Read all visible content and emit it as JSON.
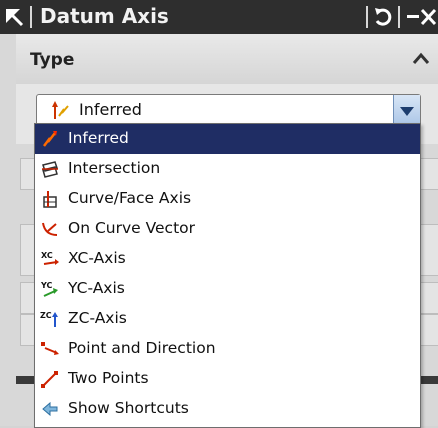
{
  "window": {
    "title": "Datum Axis"
  },
  "type_group": {
    "label": "Type"
  },
  "type_select": {
    "value": "Inferred"
  },
  "dropdown": {
    "options": [
      {
        "label": "Inferred",
        "icon": "inferred-icon",
        "selected": true
      },
      {
        "label": "Intersection",
        "icon": "intersection-icon"
      },
      {
        "label": "Curve/Face Axis",
        "icon": "curve-face-axis-icon"
      },
      {
        "label": "On Curve Vector",
        "icon": "on-curve-vector-icon"
      },
      {
        "label": "XC-Axis",
        "icon": "xc-axis-icon"
      },
      {
        "label": "YC-Axis",
        "icon": "yc-axis-icon"
      },
      {
        "label": "ZC-Axis",
        "icon": "zc-axis-icon"
      },
      {
        "label": "Point and Direction",
        "icon": "point-direction-icon"
      },
      {
        "label": "Two Points",
        "icon": "two-points-icon"
      },
      {
        "label": "Show Shortcuts",
        "icon": "show-shortcuts-icon"
      }
    ]
  },
  "colors": {
    "title_bar": "#2e2e2e",
    "selection": "#1f2d64",
    "combo_arrow": "#a9c4e6"
  }
}
